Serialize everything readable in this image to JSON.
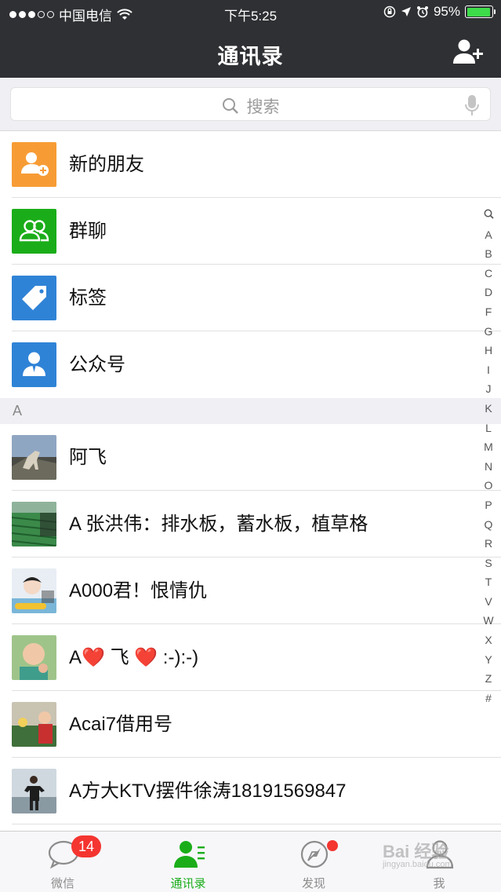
{
  "status_bar": {
    "carrier": "中国电信",
    "time": "下午5:25",
    "battery": "95%",
    "battery_level": 0.95
  },
  "nav": {
    "title": "通讯录",
    "add_icon": "add-contact-icon"
  },
  "search": {
    "placeholder": "搜索"
  },
  "features": [
    {
      "label": "新的朋友",
      "icon": "new-friend-icon",
      "color": "#f79c35"
    },
    {
      "label": "群聊",
      "icon": "group-chat-icon",
      "color": "#1aad19"
    },
    {
      "label": "标签",
      "icon": "tag-icon",
      "color": "#2f83d6"
    },
    {
      "label": "公众号",
      "icon": "official-account-icon",
      "color": "#2f83d6"
    }
  ],
  "section": {
    "letter": "A"
  },
  "contacts": [
    {
      "name": "阿飞"
    },
    {
      "name": "A 张洪伟：排水板，蓄水板，植草格"
    },
    {
      "name": "A000君！恨情仇"
    },
    {
      "name_prefix": "A",
      "heart": "❤️",
      "name_mid": " 飞 ",
      "name_suffix": " :-):-)"
    },
    {
      "name": "Acai7借用号"
    },
    {
      "name": "A方大KTV摆件徐涛18191569847"
    }
  ],
  "index_letters": [
    "A",
    "B",
    "C",
    "D",
    "F",
    "G",
    "H",
    "I",
    "J",
    "K",
    "L",
    "M",
    "N",
    "O",
    "P",
    "Q",
    "R",
    "S",
    "T",
    "V",
    "W",
    "X",
    "Y",
    "Z",
    "#"
  ],
  "tabbar": {
    "tabs": [
      {
        "label": "微信",
        "badge": "14"
      },
      {
        "label": "通讯录"
      },
      {
        "label": "发现"
      },
      {
        "label": "我"
      }
    ]
  },
  "watermark": {
    "text": "Bai 经验",
    "sub": "jingyan.baidu.com"
  },
  "colors": {
    "header": "#2f3033",
    "accent": "#1aad19",
    "badge": "#f43530"
  }
}
